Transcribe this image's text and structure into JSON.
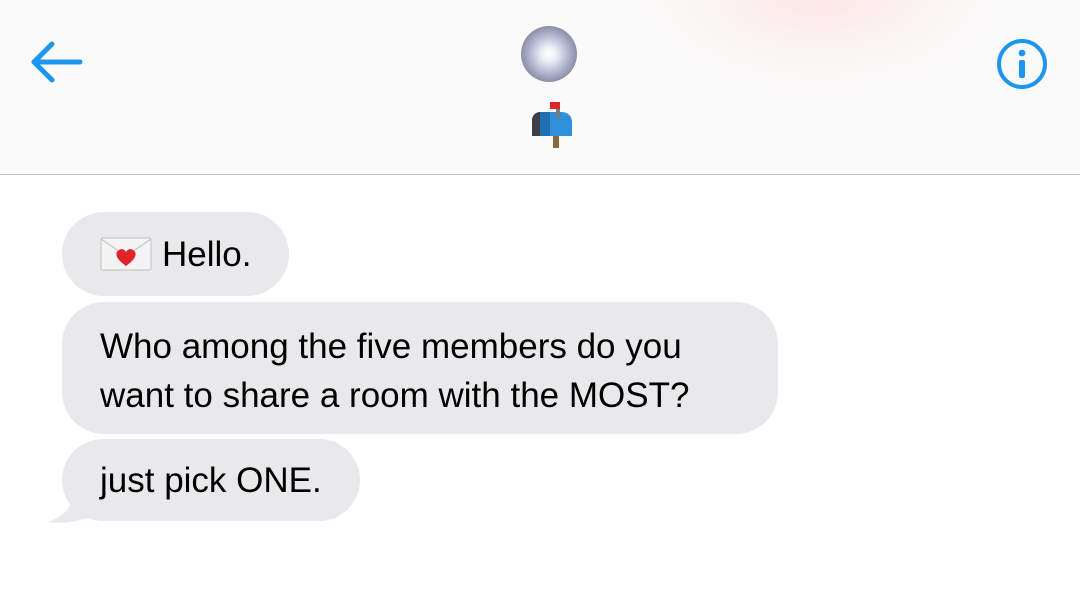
{
  "header": {
    "back_icon": "arrow-left-icon",
    "info_icon": "info-circle-icon",
    "contact_avatar": "avatar-gradient",
    "contact_name_icon": "mailbox-with-flag-emoji",
    "accent_color": "#1d96f0"
  },
  "messages": [
    {
      "icon": "love-letter-emoji",
      "text": "Hello."
    },
    {
      "lines": [
        "Who among the five members do you",
        "want to share a room with the MOST?"
      ]
    },
    {
      "text": "just pick ONE."
    }
  ],
  "colors": {
    "bubble_background": "#e9e9eb",
    "header_background": "#fafafa"
  }
}
